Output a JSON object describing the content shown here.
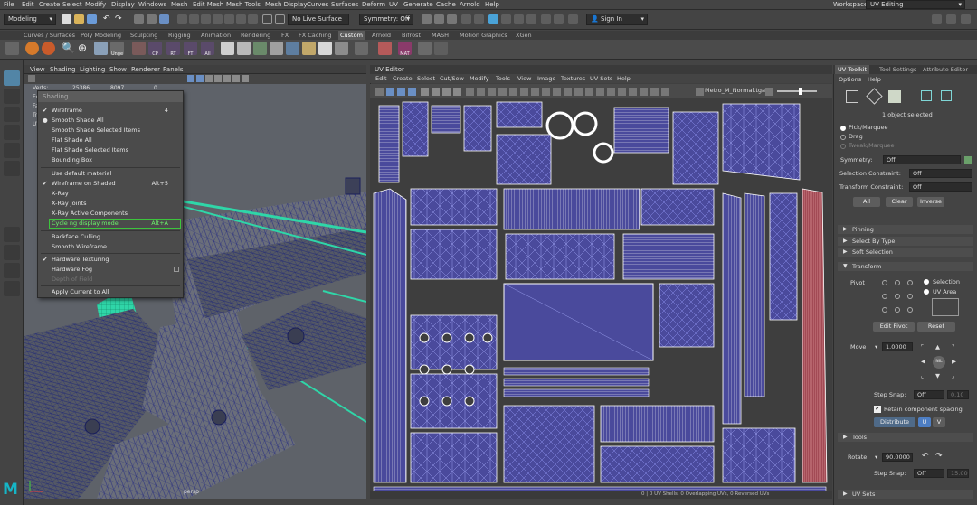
{
  "menubar": {
    "items": [
      "File",
      "Edit",
      "Create",
      "Select",
      "Modify",
      "Display",
      "Windows",
      "Mesh",
      "Edit Mesh",
      "Mesh Tools",
      "Mesh Display",
      "Curves",
      "Surfaces",
      "Deform",
      "UV",
      "Generate",
      "Cache",
      "Arnold",
      "Help"
    ],
    "workspace_label": "Workspace :",
    "workspace_value": "UV Editing"
  },
  "statusline": {
    "mode": "Modeling",
    "live_surface": "No Live Surface",
    "symmetry": "Symmetry: Off",
    "sign_in": "Sign In"
  },
  "shelf": {
    "tabs": [
      "Curves / Surfaces",
      "Poly Modeling",
      "Sculpting",
      "Rigging",
      "Animation",
      "Rendering",
      "FX",
      "FX Caching",
      "Custom",
      "Arnold",
      "Bifrost",
      "MASH",
      "Motion Graphics",
      "XGen"
    ],
    "active_tab": "Custom",
    "icon_labels": [
      "Unge",
      "CP",
      "RT",
      "FT",
      "All",
      "MAT"
    ]
  },
  "viewport": {
    "menu": [
      "View",
      "Shading",
      "Lighting",
      "Show",
      "Renderer",
      "Panels"
    ],
    "stat_labels": [
      "Verts:",
      "Edges:",
      "Faces:",
      "Tris:",
      "UVs:"
    ],
    "stat_values": [
      "25386",
      "8097",
      "0"
    ],
    "camera_label": "persp"
  },
  "shading_menu": {
    "title": "Shading",
    "items": [
      {
        "label": "Wireframe",
        "shortcut": "4",
        "mark": "check"
      },
      {
        "label": "Smooth Shade All",
        "shortcut": "",
        "mark": "dot"
      },
      {
        "label": "Smooth Shade Selected Items",
        "shortcut": "",
        "mark": ""
      },
      {
        "label": "Flat Shade All",
        "shortcut": "",
        "mark": ""
      },
      {
        "label": "Flat Shade Selected Items",
        "shortcut": "",
        "mark": ""
      },
      {
        "label": "Bounding Box",
        "shortcut": "",
        "mark": ""
      },
      {
        "label": "Use default material",
        "shortcut": "",
        "mark": ""
      },
      {
        "label": "Wireframe on Shaded",
        "shortcut": "Alt+5",
        "mark": "check"
      },
      {
        "label": "X-Ray",
        "shortcut": "",
        "mark": ""
      },
      {
        "label": "X-Ray Joints",
        "shortcut": "",
        "mark": ""
      },
      {
        "label": "X-Ray Active Components",
        "shortcut": "",
        "mark": ""
      },
      {
        "label": "Cycle ng display mode",
        "shortcut": "Alt+A",
        "mark": "",
        "highlight": true
      },
      {
        "label": "Backface Culling",
        "shortcut": "",
        "mark": ""
      },
      {
        "label": "Smooth Wireframe",
        "shortcut": "",
        "mark": ""
      },
      {
        "label": "Hardware Texturing",
        "shortcut": "",
        "mark": "check"
      },
      {
        "label": "Hardware Fog",
        "shortcut": "",
        "mark": "",
        "box": true
      },
      {
        "label": "Depth of Field",
        "shortcut": "",
        "mark": "",
        "dim": true
      },
      {
        "label": "Apply Current to All",
        "shortcut": "",
        "mark": ""
      }
    ]
  },
  "uv_editor": {
    "title": "UV Editor",
    "menu": [
      "Edit",
      "Create",
      "Select",
      "Cut/Sew",
      "Modify",
      "Tools",
      "View",
      "Image",
      "Textures",
      "UV Sets",
      "Help"
    ],
    "texture_name": "Metro_M_Normal.tga",
    "status_text": "0 | 0 UV Shells, 0 Overlapping UVs, 0 Reversed UVs"
  },
  "uv_toolkit": {
    "tabs": [
      "UV Toolkit",
      "Tool Settings",
      "Attribute Editor"
    ],
    "menu": [
      "Options",
      "Help"
    ],
    "selected_count": "1 object selected",
    "pick_modes": [
      "Pick/Marquee",
      "Drag",
      "Tweak/Marquee"
    ],
    "symmetry_label": "Symmetry:",
    "symmetry_value": "Off",
    "selection_constraint_label": "Selection Constraint:",
    "selection_constraint_value": "Off",
    "transform_constraint_label": "Transform Constraint:",
    "transform_constraint_value": "Off",
    "buttons_select": [
      "All",
      "Clear",
      "Inverse"
    ],
    "sections": [
      "Pinning",
      "Select By Type",
      "Soft Selection",
      "Transform"
    ],
    "pivot_label": "Pivot",
    "pivot_options": [
      "Selection",
      "UV Area"
    ],
    "edit_pivot": "Edit Pivot",
    "reset": "Reset",
    "move_label": "Move",
    "move_value": "1.0000",
    "center_label": "NIL",
    "step_snap_label": "Step Snap:",
    "step_snap_value": "Off",
    "step_snap_amount": "0.10",
    "retain_spacing": "Retain component spacing",
    "distribute": "Distribute",
    "u_label": "U",
    "v_label": "V",
    "tools_section": "Tools",
    "rotate_label": "Rotate",
    "rotate_value": "90.0000",
    "rotate_step_label": "Step Snap:",
    "rotate_step_value": "Off",
    "rotate_step_amount": "15.00",
    "uv_sets_section": "UV Sets"
  },
  "colors": {
    "uv_fill": "#4a4a9c",
    "uv_line": "#ffffff",
    "wire": "#2a3080",
    "highlight_green": "#3dc43d",
    "teal": "#2fd6a8"
  }
}
